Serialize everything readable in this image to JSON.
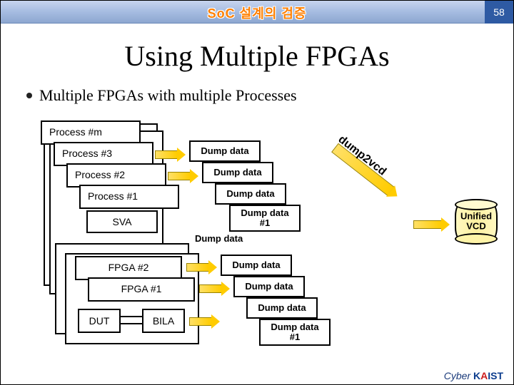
{
  "header": {
    "title": "SoC 설계의 검증",
    "page_number": "58"
  },
  "title": "Using Multiple FPGAs",
  "bullet": "Multiple FPGAs with multiple Processes",
  "processes": {
    "pm": "Process #m",
    "p3": "Process #3",
    "p2": "Process #2",
    "p1": "Process #1",
    "sva": "SVA",
    "f2": "FPGA #2",
    "f1": "FPGA #1",
    "dut": "DUT",
    "bila": "BILA"
  },
  "dump": {
    "generic": "Dump data",
    "d1": "Dump data\n#1",
    "d2": "Dump data",
    "d3": "Dump data",
    "d4": "Dump data"
  },
  "vcd": {
    "label": "Unified\nVCD"
  },
  "arrow_label": "dump2vcd",
  "footer": {
    "cyber": "Cyber",
    "k": "K",
    "a": "A",
    "ist": "IST"
  }
}
